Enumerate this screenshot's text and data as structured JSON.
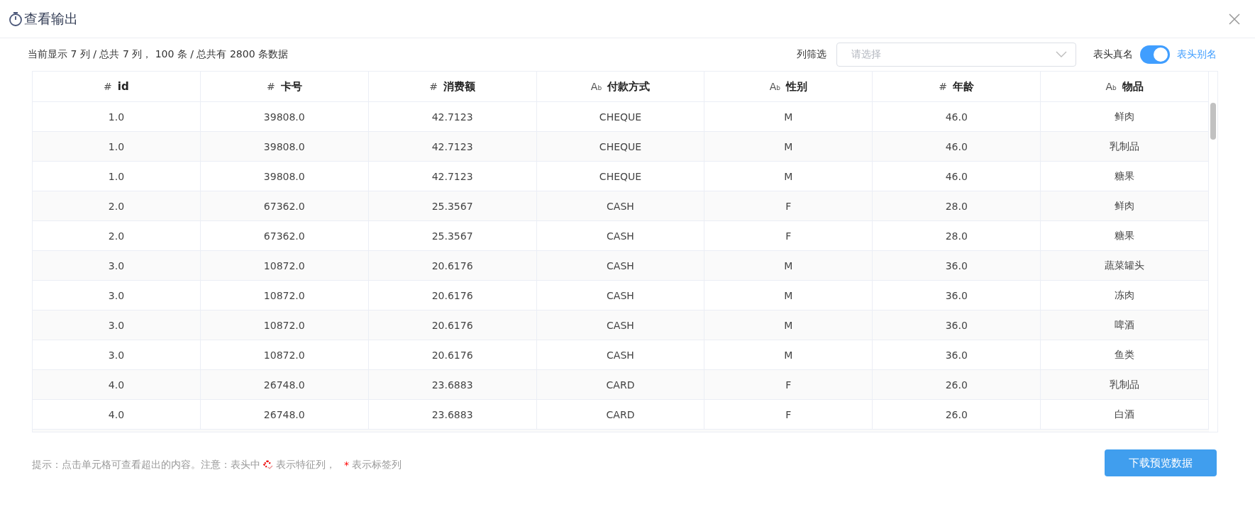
{
  "dialog": {
    "title": "查看输出"
  },
  "summary": "当前显示 7 列 / 总共 7 列， 100 条 / 总共有 2800 条数据",
  "column_filter": {
    "label": "列筛选",
    "placeholder": "请选择"
  },
  "header_toggle": {
    "off_label": "表头真名",
    "on_label": "表头别名",
    "on": true
  },
  "table": {
    "columns": [
      {
        "type_mark": "#",
        "label": "id"
      },
      {
        "type_mark": "#",
        "label": "卡号"
      },
      {
        "type_mark": "#",
        "label": "消费额"
      },
      {
        "type_mark": "A$_{b}$",
        "label": "付款方式"
      },
      {
        "type_mark": "A$_{b}$",
        "label": "性别"
      },
      {
        "type_mark": "#",
        "label": "年龄"
      },
      {
        "type_mark": "A$_{b}$",
        "label": "物品"
      }
    ],
    "rows": [
      [
        "1.0",
        "39808.0",
        "42.7123",
        "CHEQUE",
        "M",
        "46.0",
        "鲜肉"
      ],
      [
        "1.0",
        "39808.0",
        "42.7123",
        "CHEQUE",
        "M",
        "46.0",
        "乳制品"
      ],
      [
        "1.0",
        "39808.0",
        "42.7123",
        "CHEQUE",
        "M",
        "46.0",
        "糖果"
      ],
      [
        "2.0",
        "67362.0",
        "25.3567",
        "CASH",
        "F",
        "28.0",
        "鲜肉"
      ],
      [
        "2.0",
        "67362.0",
        "25.3567",
        "CASH",
        "F",
        "28.0",
        "糖果"
      ],
      [
        "3.0",
        "10872.0",
        "20.6176",
        "CASH",
        "M",
        "36.0",
        "蔬菜罐头"
      ],
      [
        "3.0",
        "10872.0",
        "20.6176",
        "CASH",
        "M",
        "36.0",
        "冻肉"
      ],
      [
        "3.0",
        "10872.0",
        "20.6176",
        "CASH",
        "M",
        "36.0",
        "啤酒"
      ],
      [
        "3.0",
        "10872.0",
        "20.6176",
        "CASH",
        "M",
        "36.0",
        "鱼类"
      ],
      [
        "4.0",
        "26748.0",
        "23.6883",
        "CARD",
        "F",
        "26.0",
        "乳制品"
      ],
      [
        "4.0",
        "26748.0",
        "23.6883",
        "CARD",
        "F",
        "26.0",
        "白酒"
      ]
    ]
  },
  "hint": {
    "before": "提示：点击单元格可查看超出的内容。注意：表头中",
    "feature": "表示特征列，",
    "label_mark": "*",
    "label": "表示标签列"
  },
  "download_button": "下载预览数据"
}
